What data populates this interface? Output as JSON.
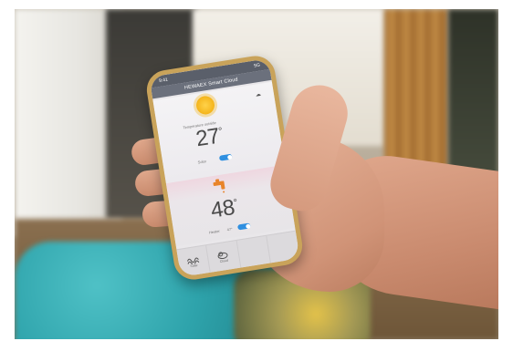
{
  "app": {
    "title": "HEWAEX Smart Cloud",
    "status_time": "9:41",
    "status_right": "5G"
  },
  "weather": {
    "label": "Temperature outside",
    "temperature": "27",
    "unit": "°",
    "toggle_label": "Solar"
  },
  "water": {
    "temperature": "48",
    "unit": "°",
    "toggle_label": "Heater",
    "setpoint": "47°"
  },
  "tabs": [
    {
      "label": "Solar",
      "icon": "wave-icon"
    },
    {
      "label": "Cloud",
      "icon": "cloud-icon"
    },
    {
      "label": "",
      "icon": "blank"
    },
    {
      "label": "",
      "icon": "blank"
    }
  ],
  "colors": {
    "toggle_on": "#2f8fe0",
    "sun": "#f4b41a",
    "tap": "#e8842a",
    "phone_frame": "#c9a35a"
  }
}
